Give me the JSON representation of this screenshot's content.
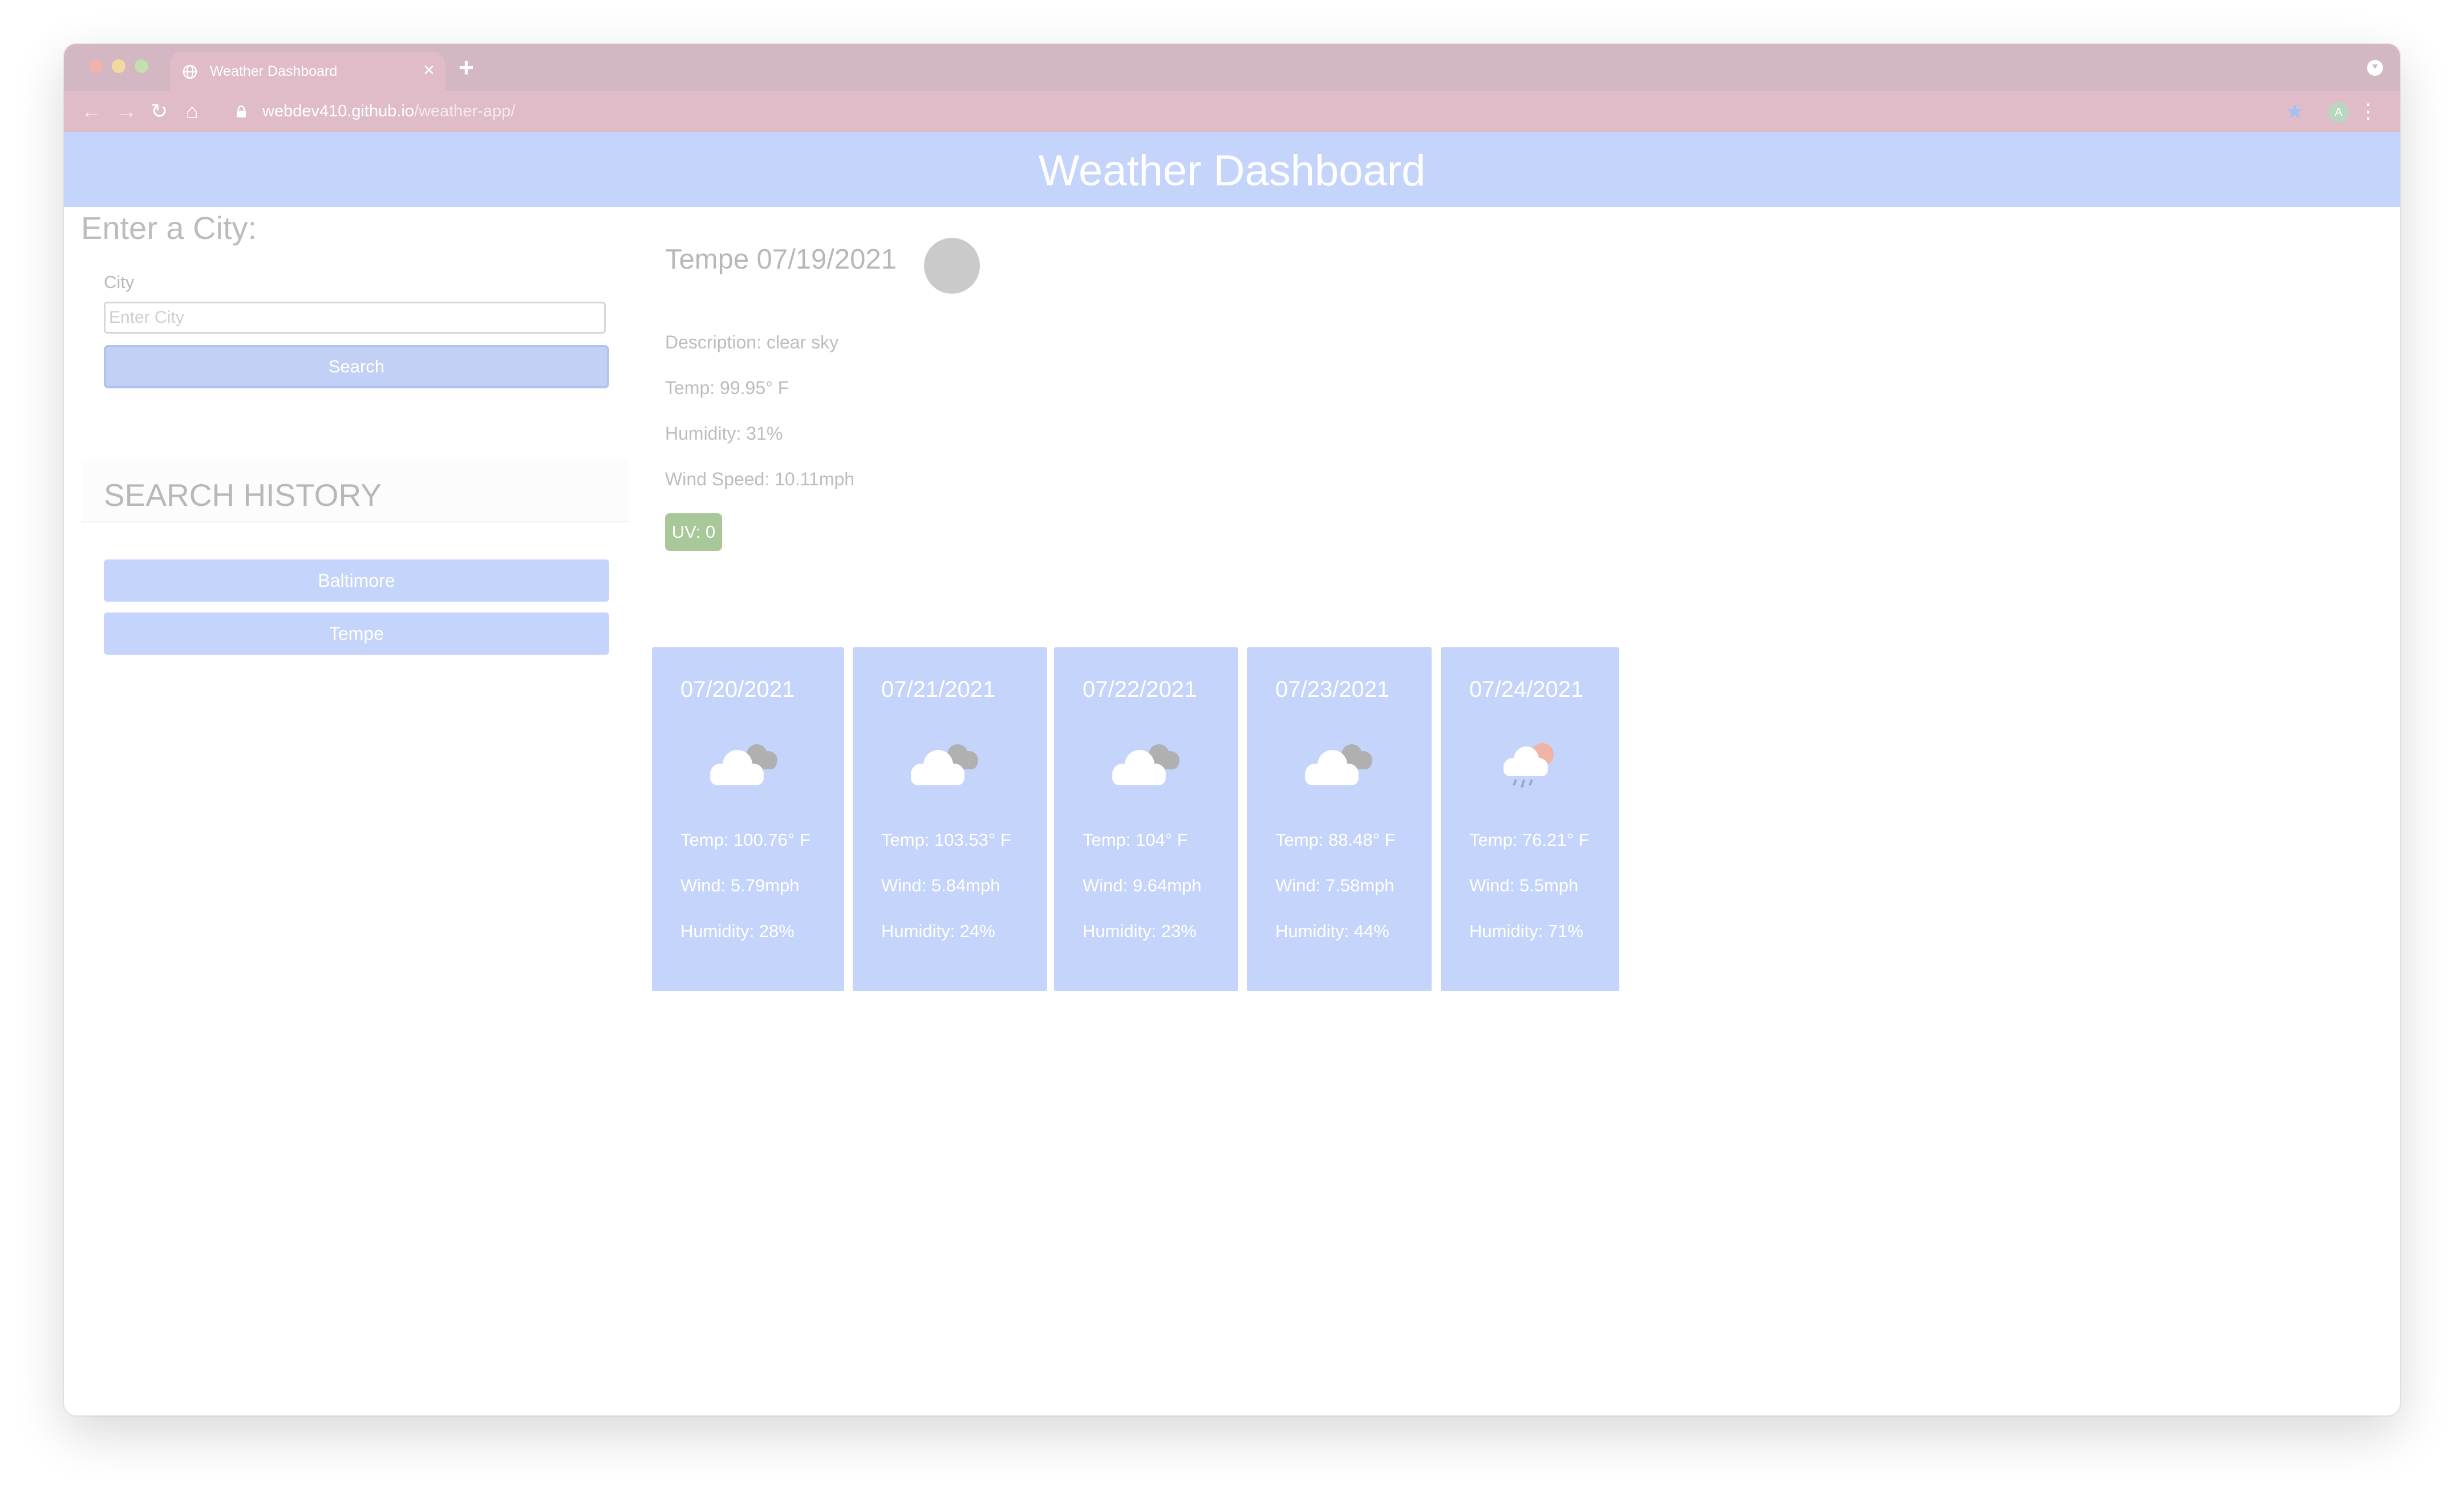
{
  "browser": {
    "tab_title": "Weather Dashboard",
    "tab_close": "×",
    "new_tab": "+",
    "url_host": "webdev410.github.io",
    "url_path": "/weather-app/",
    "profile_initial": "A",
    "icons": {
      "back": "arrow-left-icon",
      "forward": "arrow-right-icon",
      "reload": "reload-icon",
      "home": "home-icon",
      "lock": "lock-icon",
      "bookmark": "star-icon",
      "menu": "kebab-icon"
    }
  },
  "header": {
    "title": "Weather Dashboard"
  },
  "search": {
    "heading": "Enter a City:",
    "label": "City",
    "placeholder": "Enter City",
    "value": "",
    "button_label": "Search"
  },
  "history": {
    "title": "SEARCH HISTORY",
    "items": [
      "Baltimore",
      "Tempe"
    ]
  },
  "current": {
    "title": "Tempe 07/19/2021",
    "description": "Description: clear sky",
    "temp": "Temp: 99.95° F",
    "humidity": "Humidity: 31%",
    "wind": "Wind Speed: 10.11mph",
    "uv": "UV: 0",
    "uv_color": "#a9c89a"
  },
  "forecast": [
    {
      "date": "07/20/2021",
      "icon": "broken-clouds-icon",
      "temp": "Temp: 100.76° F",
      "wind": "Wind: 5.79mph",
      "humidity": "Humidity: 28%"
    },
    {
      "date": "07/21/2021",
      "icon": "broken-clouds-icon",
      "temp": "Temp: 103.53° F",
      "wind": "Wind: 5.84mph",
      "humidity": "Humidity: 24%"
    },
    {
      "date": "07/22/2021",
      "icon": "broken-clouds-icon",
      "temp": "Temp: 104° F",
      "wind": "Wind: 9.64mph",
      "humidity": "Humidity: 23%"
    },
    {
      "date": "07/23/2021",
      "icon": "broken-clouds-icon",
      "temp": "Temp: 88.48° F",
      "wind": "Wind: 7.58mph",
      "humidity": "Humidity: 44%"
    },
    {
      "date": "07/24/2021",
      "icon": "rain-sun-icon",
      "temp": "Temp: 76.21° F",
      "wind": "Wind: 5.5mph",
      "humidity": "Humidity: 71%"
    }
  ],
  "colors": {
    "header_bg": "#c4d4fb",
    "card_bg": "#c4d4fb",
    "browser_chrome": "#d3b7c2",
    "accent_button": "#c2d0f6"
  }
}
